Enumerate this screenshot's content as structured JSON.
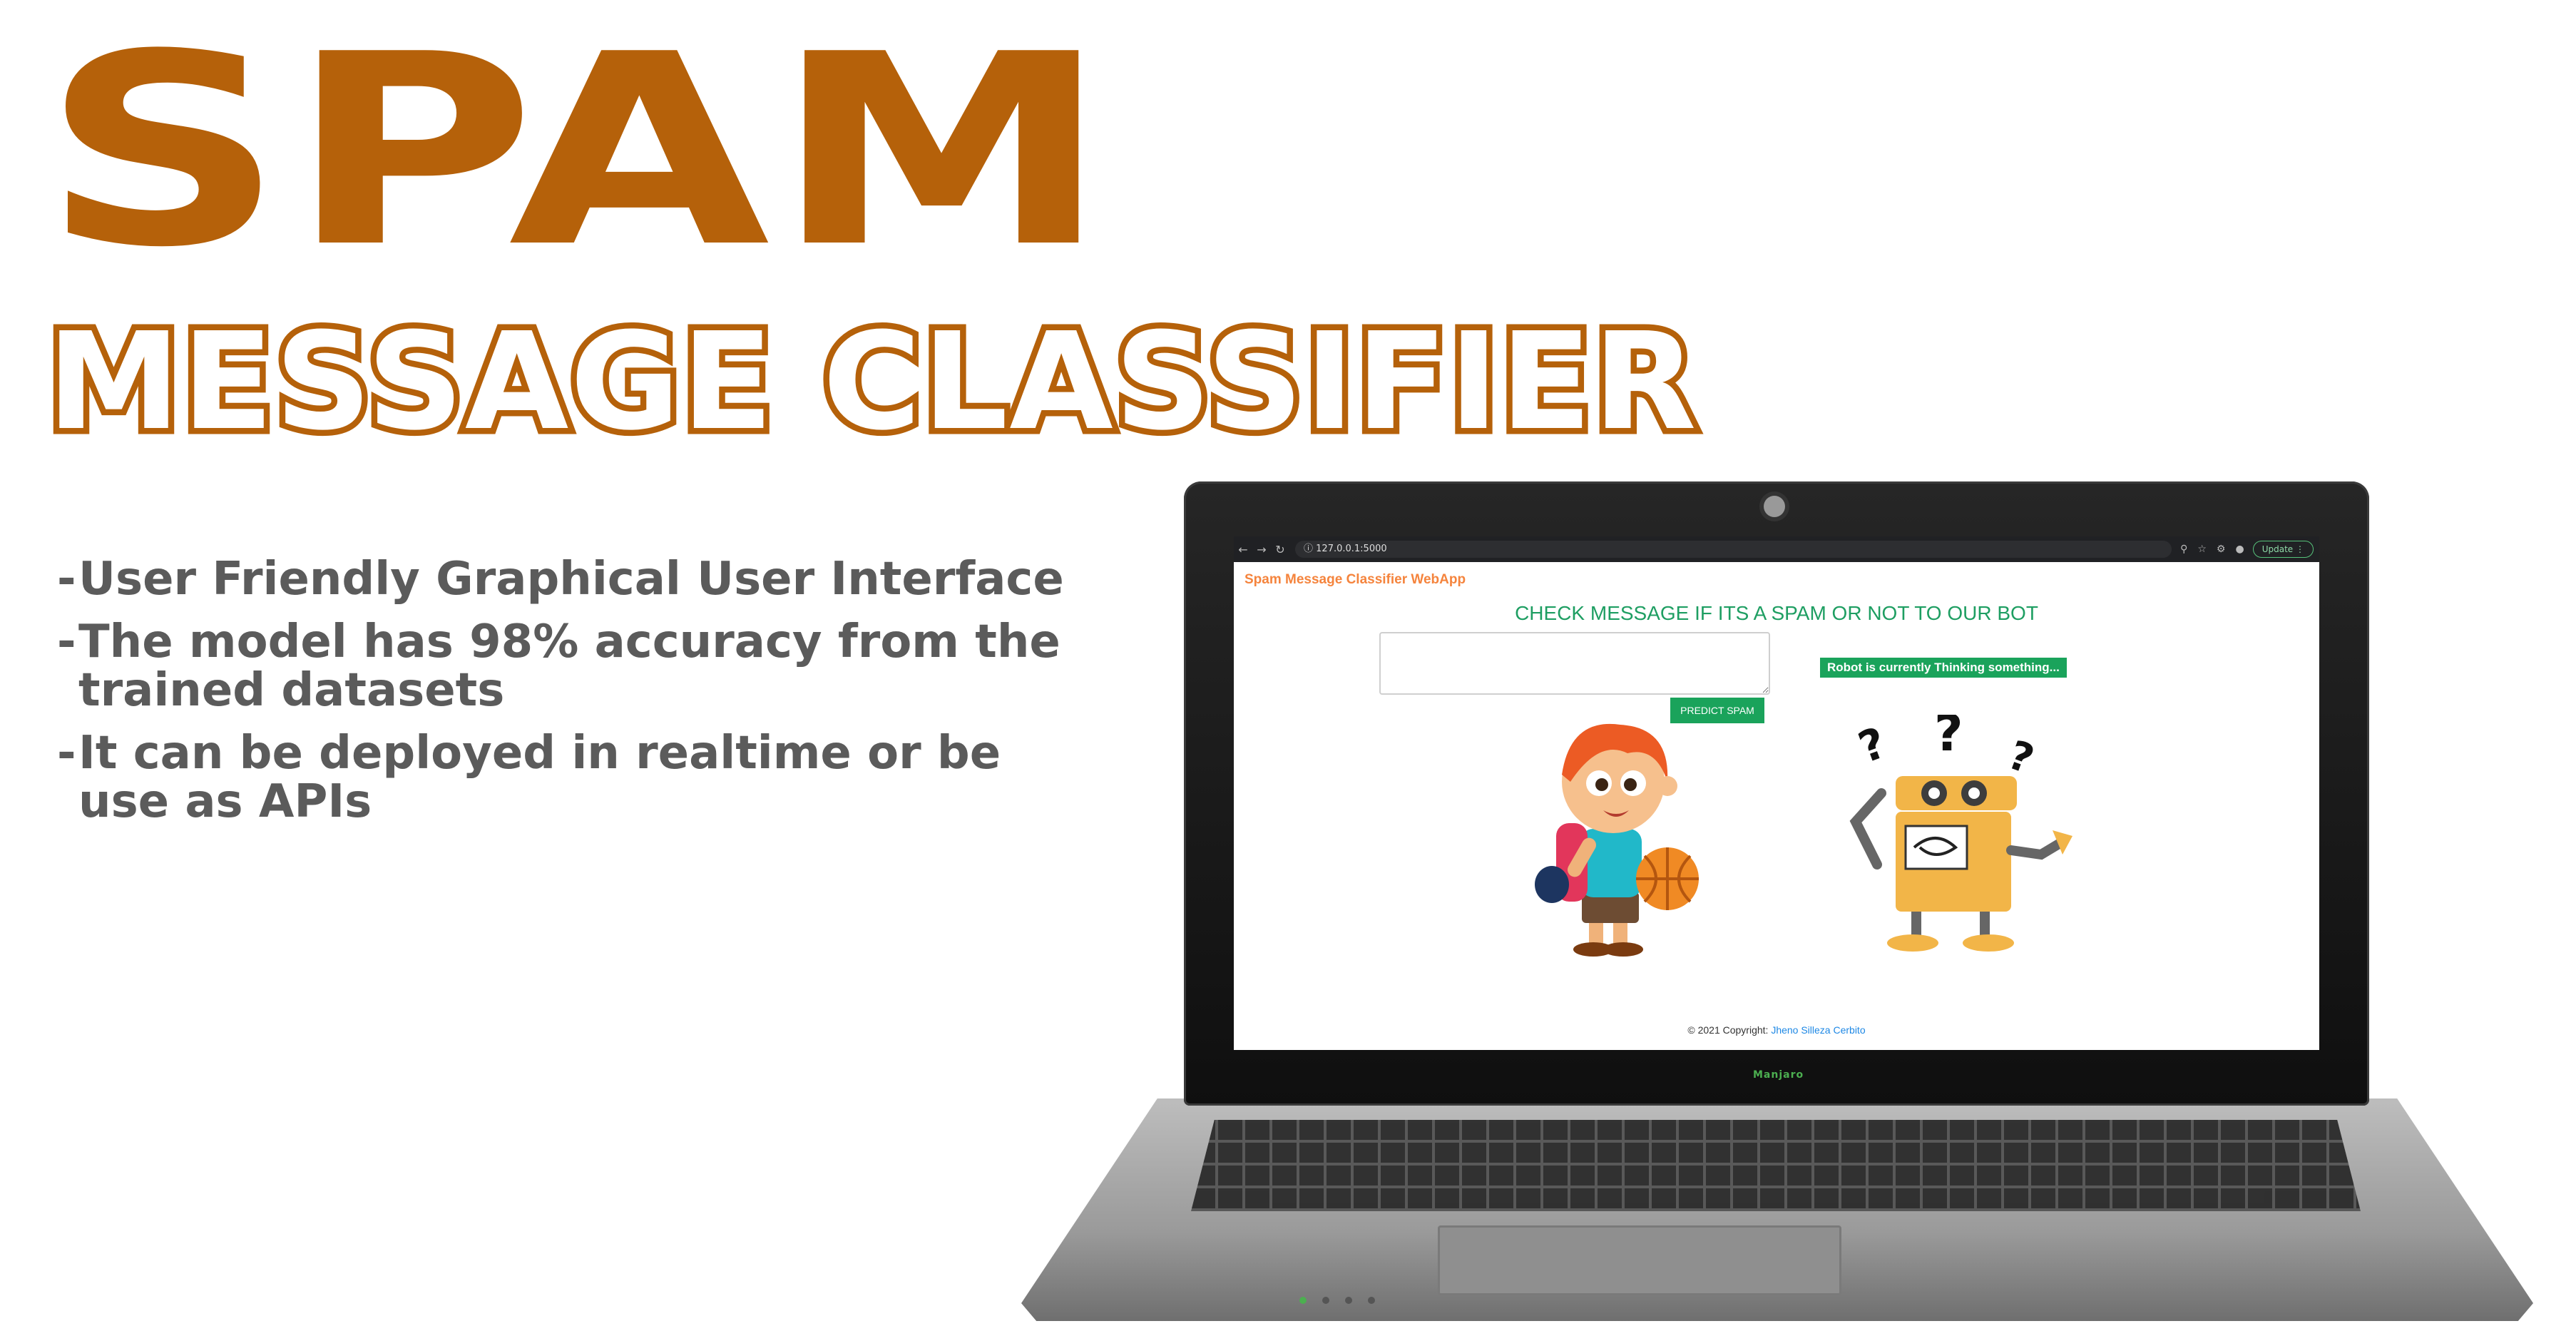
{
  "headline": {
    "title": "SPAM",
    "subtitle": "MESSAGE CLASSIFIER"
  },
  "features": [
    "User Friendly Graphical User Interface",
    "The model has 98% accuracy from the trained datasets",
    "It can be deployed in realtime or be use as  APIs"
  ],
  "browser": {
    "url": "127.0.0.1:5000",
    "update_label": "Update"
  },
  "webapp": {
    "app_name": "Spam Message Classifier WebApp",
    "heading": "CHECK MESSAGE IF ITS A SPAM OR NOT TO OUR BOT",
    "input_value": "",
    "predict_label": "PREDICT SPAM",
    "robot_status": "Robot is currently Thinking something...",
    "footer_prefix": "© 2021 Copyright:",
    "footer_author": "Jheno Silleza Cerbito"
  },
  "colors": {
    "brand_orange": "#b5610a",
    "bullet_gray": "#5b5b5b",
    "button_green": "#1aa35b",
    "heading_green": "#1e9e62",
    "app_name_orange": "#f5843d"
  },
  "icons": [
    "back-icon",
    "forward-icon",
    "reload-icon",
    "info-icon",
    "zoom-icon",
    "star-icon",
    "extensions-icon",
    "profile-icon",
    "menu-icon"
  ]
}
